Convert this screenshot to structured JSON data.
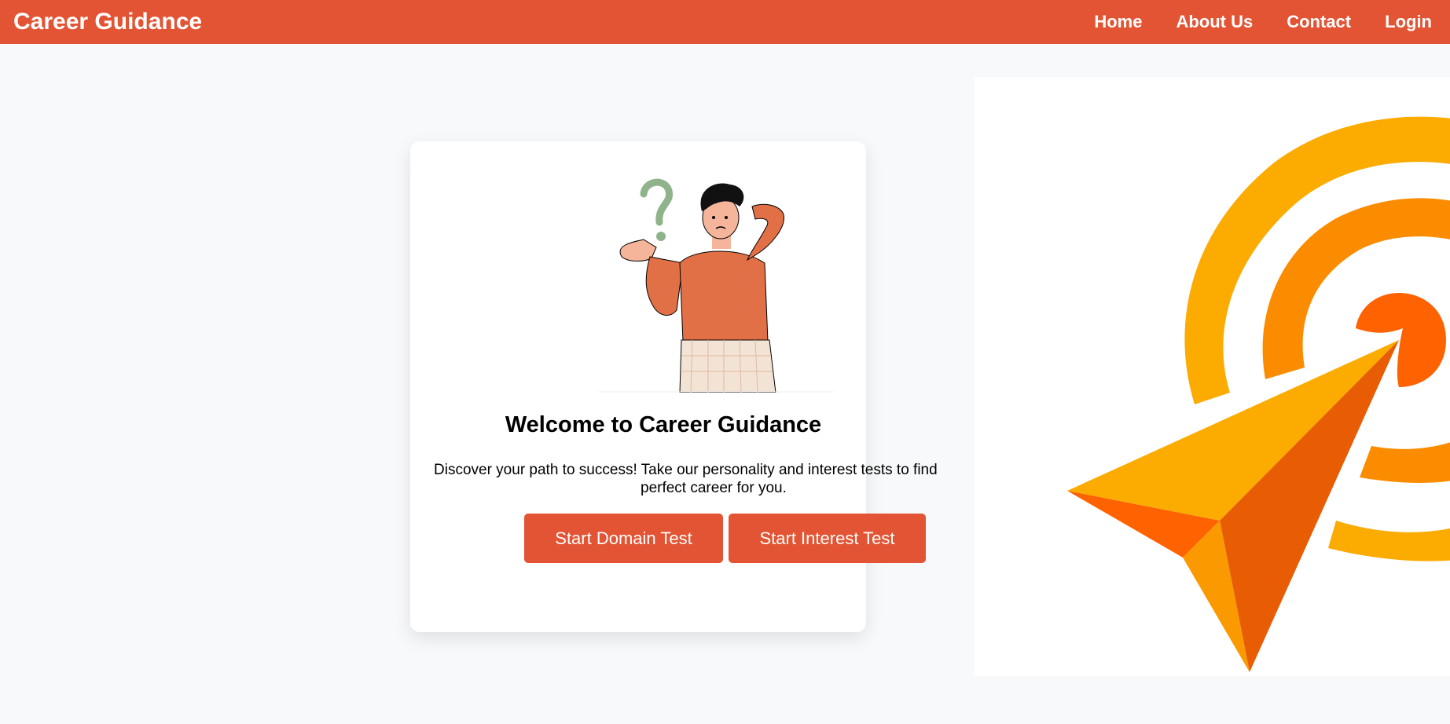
{
  "navbar": {
    "brand": "Career Guidance",
    "links": [
      {
        "label": "Home"
      },
      {
        "label": "About Us"
      },
      {
        "label": "Contact"
      },
      {
        "label": "Login"
      }
    ]
  },
  "hero": {
    "title": "Welcome to Career Guidance",
    "description_line1": "Discover your path to success! Take our personality and interest tests to find",
    "description_line2": "perfect career for you.",
    "buttons": {
      "domain_test": "Start Domain Test",
      "interest_test": "Start Interest Test"
    },
    "illustration_icon": "confused-person-illustration"
  },
  "logo": {
    "icon": "target-arrow-logo",
    "colors": {
      "outer_ring": "#fcab00",
      "middle_ring": "#fb8c00",
      "bullseye": "#ff6200",
      "arrow_light": "#fcab00",
      "arrow_dark": "#e85d04"
    }
  },
  "theme": {
    "accent": "#e35434",
    "background": "#f8f9fa"
  }
}
